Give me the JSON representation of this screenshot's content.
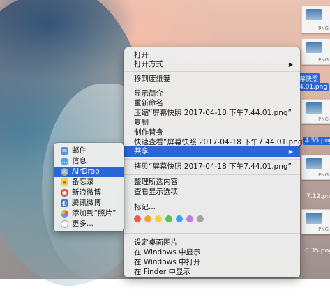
{
  "context_menu": {
    "items": [
      {
        "label": "打开"
      },
      {
        "label": "打开方式",
        "submenu_arrow": "▶"
      },
      {
        "label": "移到废纸篓"
      },
      {
        "label": "显示简介"
      },
      {
        "label": "重新命名"
      },
      {
        "label": "压缩“屏幕快照 2017-04-18 下午7.44.01.png”"
      },
      {
        "label": "复制"
      },
      {
        "label": "制作替身"
      },
      {
        "label": "快速查看“屏幕快照 2017-04-18 下午7.44.01.png”"
      },
      {
        "label": "共享",
        "submenu_arrow": "▶"
      },
      {
        "label": "拷贝“屏幕快照 2017-04-18 下午7.44.01.png”"
      },
      {
        "label": "整理所选内容"
      },
      {
        "label": "查看显示选项"
      },
      {
        "label": "标记..."
      },
      {
        "label": "设定桌面图片"
      },
      {
        "label": "在 Windows 中显示"
      },
      {
        "label": "在 Windows 中打开"
      },
      {
        "label": "在 Finder 中显示"
      }
    ],
    "tag_colors": [
      "#f0574f",
      "#f5a033",
      "#f4d03a",
      "#5ac651",
      "#3aa0f3",
      "#c37ce0",
      "#a4a4a4"
    ]
  },
  "share_submenu": {
    "items": [
      {
        "label": "邮件",
        "icon": "mail-icon",
        "color": "#5b8fe0"
      },
      {
        "label": "信息",
        "icon": "messages-icon",
        "color": "#4aa6f0"
      },
      {
        "label": "AirDrop",
        "icon": "airdrop-icon",
        "color": "#9aa7b5"
      },
      {
        "label": "备忘录",
        "icon": "notes-icon",
        "color": "#f2d04a"
      },
      {
        "label": "新浪微博",
        "icon": "weibo-icon",
        "color": "#e0492f"
      },
      {
        "label": "腾讯微博",
        "icon": "tencent-weibo-icon",
        "color": "#3c7fd1"
      },
      {
        "label": "添加到“照片”",
        "icon": "photos-icon",
        "color": "#f0a040"
      },
      {
        "label": "更多...",
        "icon": "more-icon",
        "color": "#8a8a8a"
      }
    ]
  },
  "desktop_files": [
    {
      "label": "幕快照",
      "ext": "PNG"
    },
    {
      "label": "4.01.png",
      "ext": "PNG"
    },
    {
      "label": "4.55.png",
      "ext": "PNG"
    },
    {
      "label": "7.12.png",
      "ext": "PNG"
    },
    {
      "label": "0.35.png",
      "ext": "PNG"
    }
  ]
}
